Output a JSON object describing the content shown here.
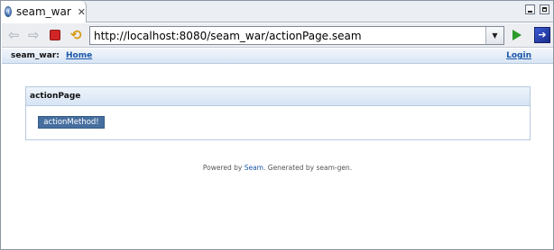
{
  "editor": {
    "tab_label": "seam_war",
    "tab_close_glyph": "✕"
  },
  "browser": {
    "url": "http://localhost:8080/seam_war/actionPage.seam",
    "url_dropdown_glyph": "▼"
  },
  "page": {
    "brand": "seam_war:",
    "nav_home": "Home",
    "nav_login": "Login",
    "panel_title": "actionPage",
    "action_button": "actionMethod!",
    "footer": {
      "prefix": "Powered by ",
      "link": "Seam",
      "suffix": ". Generated by seam-gen."
    }
  },
  "colors": {
    "link": "#1b57a8",
    "button": "#466f9f",
    "header_gradient_top": "#eef4fb",
    "header_gradient_bottom": "#d6e4f4"
  }
}
